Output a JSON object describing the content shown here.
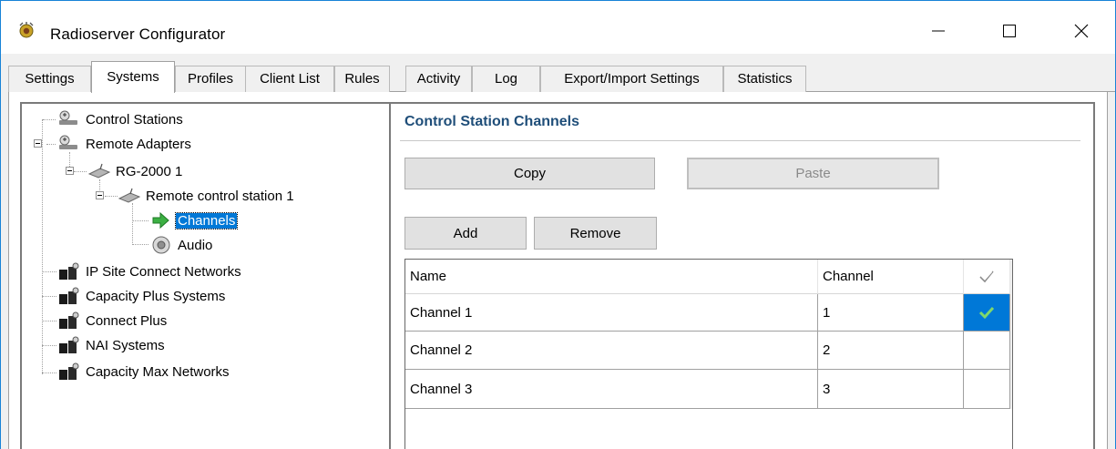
{
  "window": {
    "title": "Radioserver Configurator"
  },
  "window_controls": {
    "minimize": "—",
    "maximize": "☐",
    "close": "✕"
  },
  "tabs": [
    {
      "label": "Settings",
      "active": false
    },
    {
      "label": "Systems",
      "active": true
    },
    {
      "label": "Profiles",
      "active": false
    },
    {
      "label": "Client List",
      "active": false
    },
    {
      "label": "Rules",
      "active": false
    },
    {
      "label": "Activity",
      "active": false
    },
    {
      "label": "Log",
      "active": false
    },
    {
      "label": "Export/Import Settings",
      "active": false
    },
    {
      "label": "Statistics",
      "active": false
    }
  ],
  "tree": {
    "items": [
      {
        "label": "Control Stations",
        "icon": "control-stations-icon"
      },
      {
        "label": "Remote Adapters",
        "icon": "remote-adapters-icon"
      },
      {
        "label": "RG-2000 1",
        "icon": "router-icon"
      },
      {
        "label": "Remote control station 1",
        "icon": "router-icon"
      },
      {
        "label": "Channels",
        "icon": "green-arrow-icon",
        "selected": true
      },
      {
        "label": "Audio",
        "icon": "speaker-icon"
      },
      {
        "label": "IP Site Connect Networks",
        "icon": "network-icon"
      },
      {
        "label": "Capacity Plus Systems",
        "icon": "network-icon"
      },
      {
        "label": "Connect Plus",
        "icon": "network-icon"
      },
      {
        "label": "NAI Systems",
        "icon": "network-icon"
      },
      {
        "label": "Capacity Max Networks",
        "icon": "network-icon"
      }
    ]
  },
  "panel": {
    "title": "Control Station Channels",
    "copy_label": "Copy",
    "paste_label": "Paste",
    "add_label": "Add",
    "remove_label": "Remove"
  },
  "grid": {
    "columns": [
      "Name",
      "Channel",
      "✓"
    ],
    "rows": [
      {
        "name": "Channel 1",
        "channel": "1",
        "checked": true
      },
      {
        "name": "Channel 2",
        "channel": "2",
        "checked": false
      },
      {
        "name": "Channel 3",
        "channel": "3",
        "checked": false
      }
    ]
  },
  "colors": {
    "accent": "#0078d7",
    "title_blue": "#1f4e79",
    "check_green": "#7fd86b"
  }
}
